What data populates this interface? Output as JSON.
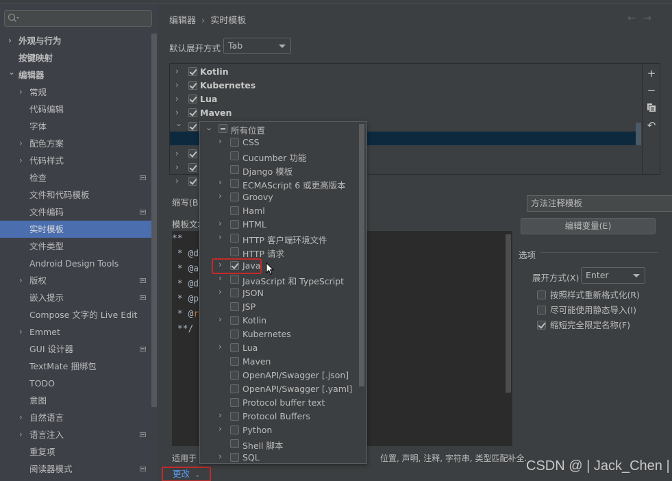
{
  "sidebar": {
    "search_placeholder": "",
    "items": [
      {
        "label": "外观与行为",
        "level": 0,
        "chevron": "right",
        "bold": true
      },
      {
        "label": "按键映射",
        "level": 0,
        "chevron": null,
        "bold": true
      },
      {
        "label": "编辑器",
        "level": 0,
        "chevron": "down",
        "bold": true
      },
      {
        "label": "常规",
        "level": 1,
        "chevron": "right"
      },
      {
        "label": "代码编辑",
        "level": 1,
        "chevron": null
      },
      {
        "label": "字体",
        "level": 1,
        "chevron": null
      },
      {
        "label": "配色方案",
        "level": 1,
        "chevron": "right"
      },
      {
        "label": "代码样式",
        "level": 1,
        "chevron": "right"
      },
      {
        "label": "检查",
        "level": 1,
        "chevron": null,
        "badge": true
      },
      {
        "label": "文件和代码模板",
        "level": 1,
        "chevron": null
      },
      {
        "label": "文件编码",
        "level": 1,
        "chevron": null,
        "badge": true
      },
      {
        "label": "实时模板",
        "level": 1,
        "chevron": null,
        "selected": true
      },
      {
        "label": "文件类型",
        "level": 1,
        "chevron": null
      },
      {
        "label": "Android Design Tools",
        "level": 1,
        "chevron": null
      },
      {
        "label": "版权",
        "level": 1,
        "chevron": "right",
        "badge": true
      },
      {
        "label": "嵌入提示",
        "level": 1,
        "chevron": null,
        "badge": true
      },
      {
        "label": "Compose 文字的 Live Edit",
        "level": 1,
        "chevron": null
      },
      {
        "label": "Emmet",
        "level": 1,
        "chevron": "right"
      },
      {
        "label": "GUI 设计器",
        "level": 1,
        "chevron": null,
        "badge": true
      },
      {
        "label": "TextMate 捆绑包",
        "level": 1,
        "chevron": null
      },
      {
        "label": "TODO",
        "level": 1,
        "chevron": null
      },
      {
        "label": "意图",
        "level": 1,
        "chevron": null
      },
      {
        "label": "自然语言",
        "level": 1,
        "chevron": "right"
      },
      {
        "label": "语言注入",
        "level": 1,
        "chevron": "right",
        "badge": true
      },
      {
        "label": "重复项",
        "level": 1,
        "chevron": null
      },
      {
        "label": "阅读器模式",
        "level": 1,
        "chevron": null,
        "badge": true
      }
    ]
  },
  "header": {
    "breadcrumb": [
      "编辑器",
      "实时模板"
    ],
    "back_icon": "arrow-left-icon",
    "forward_icon": "arrow-right-icon"
  },
  "expand_default": {
    "label": "默认展开方式",
    "value": "Tab"
  },
  "template_tree": {
    "groups": [
      {
        "label": "Kotlin",
        "checked": true,
        "expanded": false
      },
      {
        "label": "Kubernetes",
        "checked": true,
        "expanded": false
      },
      {
        "label": "Lua",
        "checked": true,
        "expanded": false
      },
      {
        "label": "Maven",
        "checked": true,
        "expanded": false
      },
      {
        "label": "",
        "checked": true,
        "expanded": true
      },
      {
        "label": "",
        "checked": true,
        "expanded": false,
        "selected_child": true
      },
      {
        "label": "",
        "checked": true,
        "expanded": false
      },
      {
        "label": "",
        "checked": true,
        "expanded": false
      }
    ],
    "tools": [
      "add-icon",
      "remove-icon",
      "copy-icon",
      "restore-icon"
    ]
  },
  "abbreviation": {
    "label": "缩写(B)",
    "description_value": "方法注释模板"
  },
  "template_text": {
    "label": "模板文本",
    "lines": [
      {
        "prefix": "**",
        "tag": ""
      },
      {
        "prefix": " * @d",
        "tag": ""
      },
      {
        "prefix": " * @a",
        "tag": ""
      },
      {
        "prefix": " * @d",
        "tag": ""
      },
      {
        "prefix": " * @p",
        "tag": ""
      },
      {
        "prefix": " * @",
        "tag": "r"
      },
      {
        "prefix": " **/",
        "tag": ""
      }
    ]
  },
  "edit_variables_label": "编辑变量(E)",
  "options": {
    "title": "选项",
    "expand_with_label": "展开方式(X)",
    "expand_with_value": "Enter",
    "checkboxes": [
      {
        "label": "按照样式重新格式化(R)",
        "checked": false
      },
      {
        "label": "尽可能使用静态导入(I)",
        "checked": false
      },
      {
        "label": "缩短完全限定名称(F)",
        "checked": true
      }
    ]
  },
  "applies_to": {
    "prefix": "适用于",
    "suffix": "位置, 声明, 注释, 字符串, 类型匹配补全."
  },
  "change_link": "更改",
  "context_popup": {
    "root": {
      "label": "所有位置",
      "state": "indeterminate"
    },
    "items": [
      {
        "label": "CSS",
        "expandable": true,
        "checked": false
      },
      {
        "label": "Cucumber 功能",
        "expandable": false,
        "checked": false
      },
      {
        "label": "Django 模板",
        "expandable": false,
        "checked": false
      },
      {
        "label": "ECMAScript 6 或更高版本",
        "expandable": true,
        "checked": false
      },
      {
        "label": "Groovy",
        "expandable": true,
        "checked": false
      },
      {
        "label": "Haml",
        "expandable": false,
        "checked": false
      },
      {
        "label": "HTML",
        "expandable": true,
        "checked": false
      },
      {
        "label": "HTTP 客户端环境文件",
        "expandable": true,
        "checked": false
      },
      {
        "label": "HTTP 请求",
        "expandable": false,
        "checked": false
      },
      {
        "label": "Java",
        "expandable": true,
        "checked": true,
        "highlighted": true
      },
      {
        "label": "JavaScript 和 TypeScript",
        "expandable": true,
        "checked": false
      },
      {
        "label": "JSON",
        "expandable": true,
        "checked": false
      },
      {
        "label": "JSP",
        "expandable": false,
        "checked": false
      },
      {
        "label": "Kotlin",
        "expandable": true,
        "checked": false
      },
      {
        "label": "Kubernetes",
        "expandable": false,
        "checked": false
      },
      {
        "label": "Lua",
        "expandable": true,
        "checked": false
      },
      {
        "label": "Maven",
        "expandable": false,
        "checked": false
      },
      {
        "label": "OpenAPI/Swagger [.json]",
        "expandable": false,
        "checked": false
      },
      {
        "label": "OpenAPI/Swagger [.yaml]",
        "expandable": false,
        "checked": false
      },
      {
        "label": "Protocol buffer text",
        "expandable": false,
        "checked": false
      },
      {
        "label": "Protocol Buffers",
        "expandable": true,
        "checked": false
      },
      {
        "label": "Python",
        "expandable": true,
        "checked": false
      },
      {
        "label": "Shell 脚本",
        "expandable": false,
        "checked": false
      },
      {
        "label": "SQL",
        "expandable": true,
        "checked": false
      }
    ]
  },
  "watermark": "CSDN @ | Jack_Chen |"
}
